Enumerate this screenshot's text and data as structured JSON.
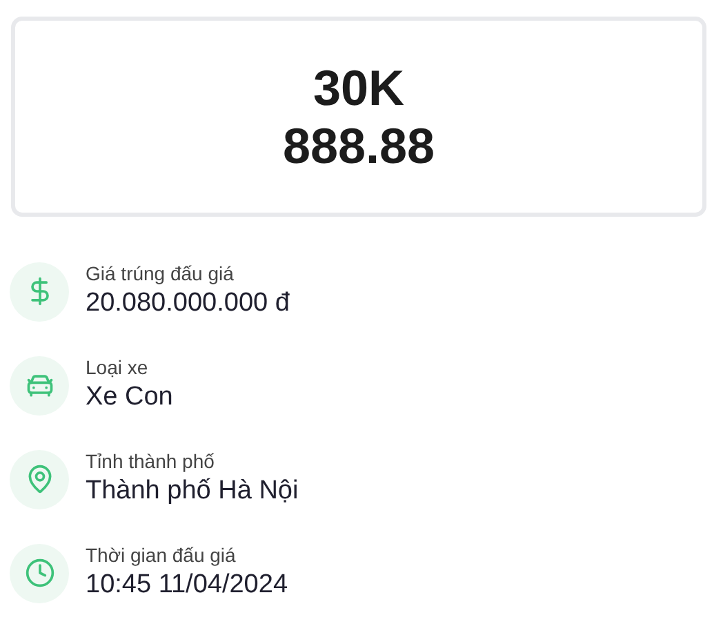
{
  "plate": {
    "line_1": "30K",
    "line_2": "888.88"
  },
  "details": [
    {
      "kind": "price",
      "label": "Giá trúng đấu giá",
      "value": "20.080.000.000 đ"
    },
    {
      "kind": "vehicle",
      "label": "Loại xe",
      "value": "Xe Con"
    },
    {
      "kind": "location",
      "label": "Tỉnh thành phố",
      "value": "Thành phố Hà Nội"
    },
    {
      "kind": "time",
      "label": "Thời gian đấu giá",
      "value": "10:45 11/04/2024"
    }
  ]
}
